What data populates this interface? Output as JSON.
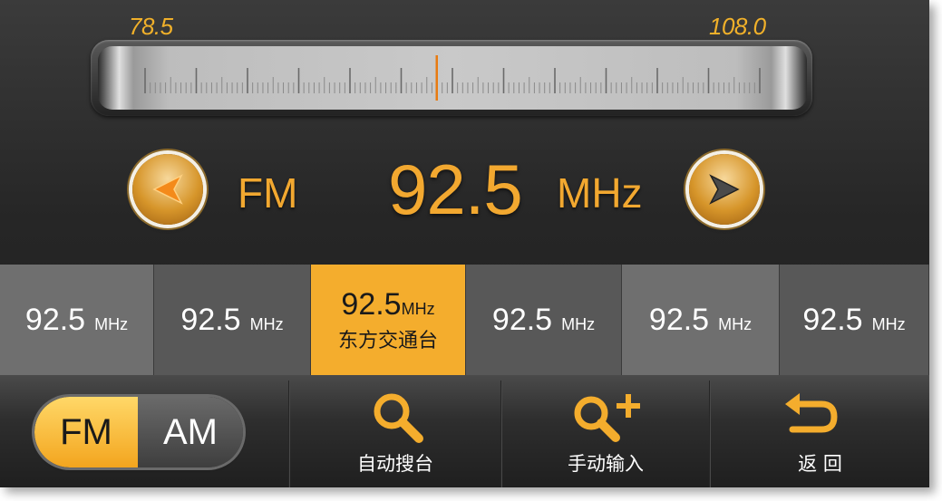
{
  "tuner": {
    "range_min": "78.5",
    "range_max": "108.0",
    "current_position": 92.5,
    "min_value": 78.5,
    "max_value": 108.0
  },
  "display": {
    "band": "FM",
    "frequency": "92.5",
    "unit": "MHz"
  },
  "presets": [
    {
      "frequency": "92.5",
      "unit": "MHz",
      "name": "",
      "active": false
    },
    {
      "frequency": "92.5",
      "unit": "MHz",
      "name": "",
      "active": false
    },
    {
      "frequency": "92.5",
      "unit": "MHz",
      "name": "东方交通台",
      "active": true
    },
    {
      "frequency": "92.5",
      "unit": "MHz",
      "name": "",
      "active": false
    },
    {
      "frequency": "92.5",
      "unit": "MHz",
      "name": "",
      "active": false
    },
    {
      "frequency": "92.5",
      "unit": "MHz",
      "name": "",
      "active": false
    }
  ],
  "band_toggle": {
    "fm_label": "FM",
    "am_label": "AM",
    "selected": "FM"
  },
  "actions": {
    "auto_search": "自动搜台",
    "manual_input": "手动输入",
    "back": "返 回"
  },
  "colors": {
    "accent": "#f4ad2d",
    "text_accent": "#f2a830",
    "indicator": "#e87a10"
  },
  "icons": {
    "prev": "left-arrow-icon",
    "next": "right-arrow-icon",
    "auto_search": "search-icon",
    "manual_input": "search-plus-icon",
    "back": "return-icon"
  }
}
